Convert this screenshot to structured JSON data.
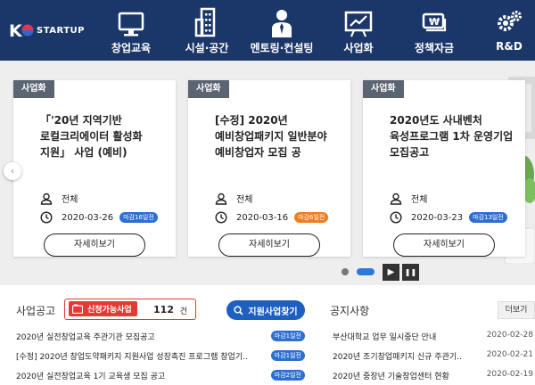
{
  "header": {
    "logo": "STARTUP",
    "nav": [
      {
        "label": "창업교육",
        "icon": "monitor-icon"
      },
      {
        "label": "시설·공간",
        "icon": "building-icon"
      },
      {
        "label": "멘토링·컨설팅",
        "icon": "mentor-person-icon"
      },
      {
        "label": "사업화",
        "icon": "chart-board-icon"
      },
      {
        "label": "정책자금",
        "icon": "money-icon"
      },
      {
        "label": "R&D",
        "icon": "gears-icon"
      }
    ]
  },
  "hero": {
    "cards": [
      {
        "tag": "사업화",
        "title": "「'20년 지역기반 로컬크리에이터 활성화 지원」 사업 (예비)",
        "target": "전체",
        "date": "2020-03-26",
        "badge": "마감16일전",
        "badge_color": "#2d6fd1",
        "button": "자세히보기"
      },
      {
        "tag": "사업화",
        "title": "[수정] 2020년 예비창업패키지 일반분야 예비창업자 모집 공",
        "target": "전체",
        "date": "2020-03-16",
        "badge": "마감6일전",
        "badge_color": "#ef7d22",
        "button": "자세히보기"
      },
      {
        "tag": "사업화",
        "title": "2020년도 사내벤처 육성프로그램 1차 운영기업 모집공고",
        "target": "전체",
        "date": "2020-03-23",
        "badge": "마감13일전",
        "badge_color": "#2d6fd1",
        "button": "자세히보기"
      }
    ],
    "prev_arrow": "‹",
    "play_icon": "▶",
    "pause_icon": "❚❚"
  },
  "business": {
    "title": "사업공고",
    "available_label": "신청가능사업",
    "count": "112",
    "count_unit": "건",
    "search_button": "지원사업찾기",
    "rows": [
      {
        "title": "2020년 실전창업교육 주관기관 모집공고",
        "badge": "마감1일전",
        "badge_color": "#2d6fd1"
      },
      {
        "title": "[수정] 2020년 창업도약패키지 지원사업 성장촉진 프로그램 창업기..",
        "badge": "마감1일전",
        "badge_color": "#2d6fd1"
      },
      {
        "title": "2020년 실전창업교육 1기 교육생 모집 공고",
        "badge": "마감2일전",
        "badge_color": "#2d6fd1"
      }
    ]
  },
  "notice": {
    "title": "공지사항",
    "more": "더보기",
    "rows": [
      {
        "title": "부산대학교 업무 일시중단 안내",
        "date": "2020-02-28"
      },
      {
        "title": "2020년 조기창업패키지 신규 주관기..",
        "date": "2020-02-21"
      },
      {
        "title": "2020년 중장년 기술창업센터 현황",
        "date": "2020-02-19"
      }
    ]
  },
  "colors": {
    "header": "#1b3669",
    "accent_red": "#e53935",
    "accent_blue": "#1e5fbf"
  }
}
